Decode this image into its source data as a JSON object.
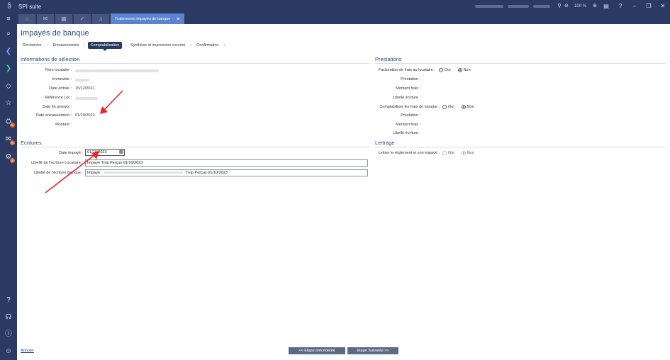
{
  "app": {
    "title": "SPI suite",
    "zoom": "100 %"
  },
  "tabs": {
    "active_label": "Traitements impayés de banque"
  },
  "page": {
    "title": "Impayés de banque"
  },
  "breadcrumb": [
    "Recherche",
    "Encaissements",
    "Comptabilisation",
    "Synthèse et impression courrier",
    "Confirmation"
  ],
  "selection": {
    "title": "Informations de sélection",
    "labels": {
      "nom_locataire": "Nom locataire :",
      "immeuble": "Immeuble :",
      "date_entree": "Date entrée :",
      "reference_lot": "Référence Lot :",
      "date_fin_preavis": "Date fin préavis :",
      "date_encaissement": "Date encaissement :",
      "montant": "Montant :"
    },
    "values": {
      "date_entree": "15/12/2021",
      "date_encaissement": "01/10/2023"
    }
  },
  "ecritures": {
    "title": "Ecritures",
    "date_impaye_label": "Date impayé :",
    "date_impaye_value": "01/10/2023",
    "libelle_locataire_label": "Libellé de l'écriture Locataire :",
    "libelle_locataire_value": "Impayé Trop Perçus 01/10/2023",
    "libelle_banque_label": "Libellé de l'écriture Banque :",
    "libelle_banque_prefix": "Impayé",
    "libelle_banque_suffix": "Trop Perçus 01/10/2023"
  },
  "prestations": {
    "title": "Prestations",
    "facturation_label": "Facturation de frais au locataire :",
    "oui": "Oui",
    "non": "Non",
    "prestation_label": "Prestation :",
    "montant_frais_label": "Montant frais :",
    "libelle_ecriture_label": "Libellé écriture :",
    "comptabiliser_label": "Comptabiliser les frais de banque :"
  },
  "lettrage": {
    "title": "Lettrage",
    "label": "Lettrer le règlement et son impayé :",
    "oui": "Oui",
    "non": "Non"
  },
  "footer": {
    "cancel": "Annuler",
    "previous": "<< Etape précédente",
    "next": "Etape Suivante >>"
  },
  "colors": {
    "sidebar": "#2b3a62",
    "accent": "#5b83cf",
    "arrow": "#e8262b"
  }
}
